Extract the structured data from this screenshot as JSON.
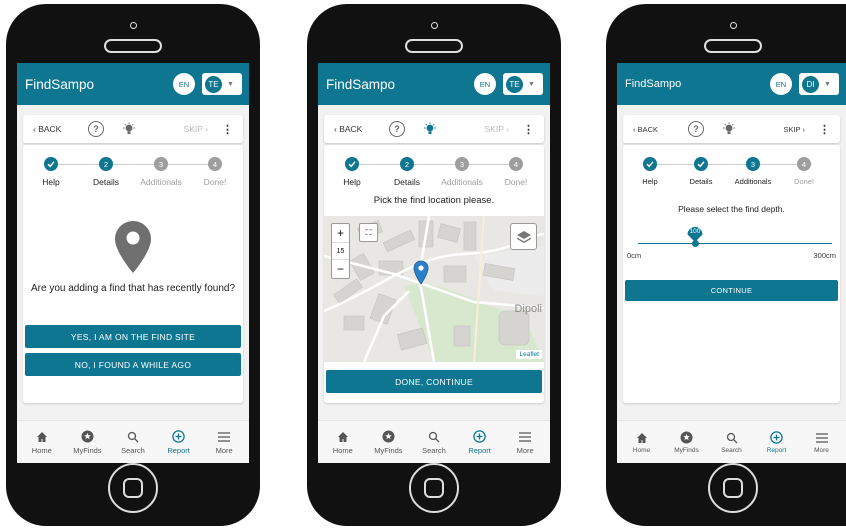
{
  "brand_color": "#0e7690",
  "app_title": "FindSampo",
  "bottom_nav": [
    "Home",
    "MyFinds",
    "Search",
    "Report",
    "More"
  ],
  "steps": [
    "Help",
    "Details",
    "Additionals",
    "Done!"
  ],
  "phone1": {
    "lang": "EN",
    "user_initials": "TE",
    "back": "BACK",
    "help": "?",
    "skip": "SKIP",
    "more": "⋮",
    "step_numbers": [
      "2",
      "3",
      "4"
    ],
    "question": "Are you adding a find that has recently found?",
    "btn_on_site": "YES, I AM ON THE FIND SITE",
    "btn_while_ago": "NO, I FOUND A WHILE AGO"
  },
  "phone2": {
    "lang": "EN",
    "user_initials": "TE",
    "back": "BACK",
    "help": "?",
    "skip": "SKIP",
    "more": "⋮",
    "step_numbers": [
      "2",
      "3",
      "4"
    ],
    "prompt": "Pick the find location please.",
    "zoom_in": "+",
    "zoom_level": "15",
    "zoom_out": "−",
    "map_place": "Dipoli",
    "attribution": "Leaflet",
    "btn_continue": "DONE, CONTINUE"
  },
  "phone3": {
    "lang": "EN",
    "user_initials": "DI",
    "back": "BACK",
    "help": "?",
    "skip": "SKIP",
    "more": "⋮",
    "step_numbers": [
      "3",
      "4"
    ],
    "prompt": "Please select the find depth.",
    "depth_value": "100",
    "depth_fraction": 0.333,
    "scale_min": "0cm",
    "scale_max": "300cm",
    "btn_continue": "CONTINUE"
  }
}
